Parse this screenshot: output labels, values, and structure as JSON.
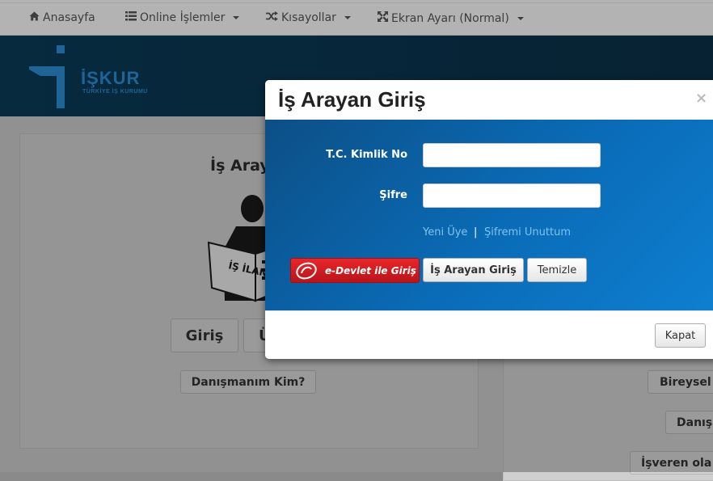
{
  "nav": {
    "home": "Anasayfa",
    "online": "Online İşlemler",
    "shortcuts": "Kısayollar",
    "screen": "Ekran Ayarı (Normal)"
  },
  "icons": {
    "home": "home-icon",
    "list": "list-icon",
    "shuffle": "shuffle-icon",
    "expand": "expand-icon",
    "close": "close-icon"
  },
  "banner": {
    "logo_text": "İŞKUR",
    "logo_sub": "TÜRKİYE İŞ KURUMU"
  },
  "background": {
    "panel_title": "İş Aray",
    "login_btn": "Giriş",
    "second_btn": "Ü",
    "advisor_btn": "Danışmanım Kim?",
    "right_btn1": "Bireysel",
    "right_btn2": "Danış",
    "right_btn3": "İşveren ola",
    "sign_text": "İŞ İLANLARI"
  },
  "modal": {
    "title": "İş Arayan Giriş",
    "close": "×",
    "tc_label": "T.C. Kimlik No",
    "tc_value": "",
    "password_label": "Şifre",
    "password_value": "",
    "new_member": "Yeni Üye",
    "separator": "|",
    "forgot_password": "Şifremi Unuttum",
    "edevlet_label": "e-Devlet ile Giriş",
    "login_label": "İş Arayan Giriş",
    "clear_label": "Temizle",
    "close_button": "Kapat"
  },
  "colors": {
    "modal_body": "#0a6cb8",
    "edevlet_red": "#d01f24",
    "banner": "#0b3b57",
    "link": "#7fc4f0"
  }
}
